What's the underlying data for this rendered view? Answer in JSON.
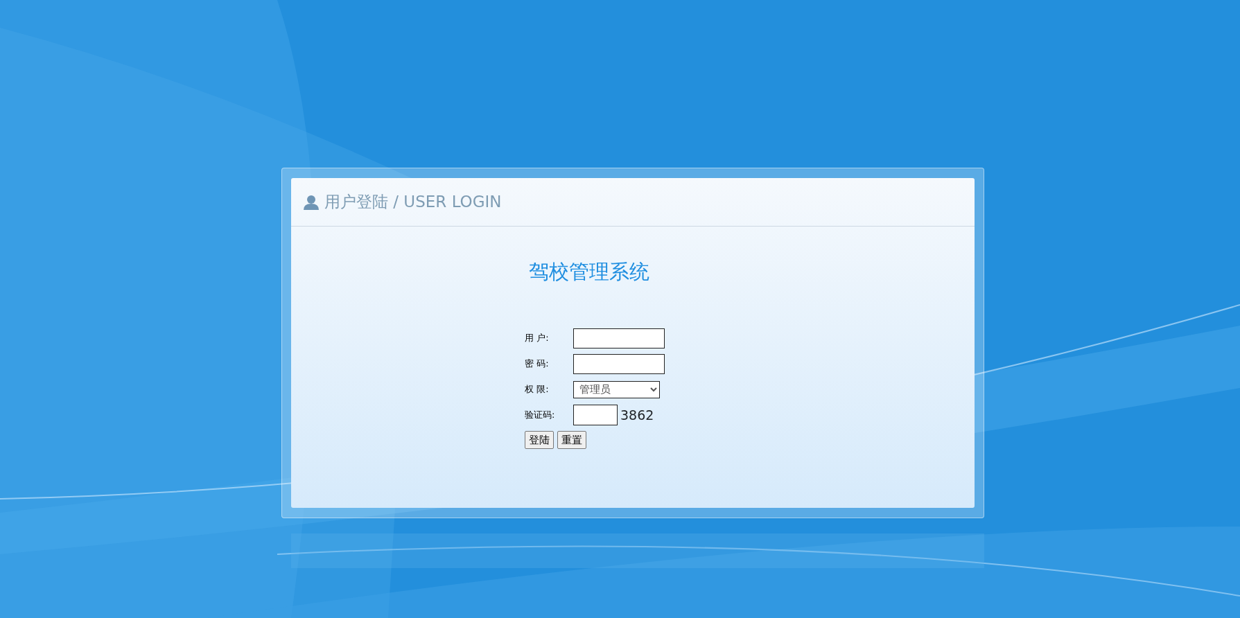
{
  "panel": {
    "title": "用户登陆 / USER LOGIN"
  },
  "system_title": "驾校管理系统",
  "fields": [
    {
      "kind": "text",
      "label": "用 户:"
    },
    {
      "kind": "password",
      "label": "密 码:"
    },
    {
      "kind": "select",
      "label": "权 限:",
      "value": "管理员"
    },
    {
      "kind": "captcha",
      "label": "验证码:",
      "code": "3862"
    }
  ],
  "buttons": [
    "登陆",
    "重置"
  ]
}
